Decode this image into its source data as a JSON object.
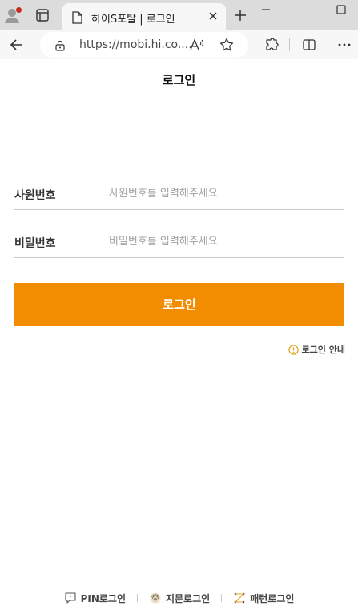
{
  "browser": {
    "tab_title": "하이S포탈 | 로그인",
    "url": "https://mobi.hi.co....",
    "icons": [
      "profile-icon",
      "tab-actions-icon",
      "page-icon",
      "close-icon",
      "new-tab-icon",
      "minimize-icon",
      "maximize-icon",
      "back-arrow-icon",
      "lock-icon",
      "read-aloud-icon",
      "favorite-star-icon",
      "extensions-icon",
      "split-screen-icon",
      "more-icon"
    ]
  },
  "page": {
    "title": "로그인"
  },
  "form": {
    "employee_id": {
      "label": "사원번호",
      "placeholder": "사원번호를 입력해주세요",
      "value": ""
    },
    "password": {
      "label": "비밀번호",
      "placeholder": "비밀번호를 입력해주세요",
      "value": ""
    },
    "login_button": "로그인",
    "guide_link": "로그인 안내"
  },
  "alt_logins": [
    {
      "label": "PIN로그인",
      "icon": "pin-chat-icon"
    },
    {
      "label": "지문로그인",
      "icon": "fingerprint-icon"
    },
    {
      "label": "패턴로그인",
      "icon": "pattern-icon"
    }
  ],
  "colors": {
    "accent": "#f28c00",
    "profile_badge": "#c42b1c",
    "guide_icon": "#e0a21a"
  }
}
